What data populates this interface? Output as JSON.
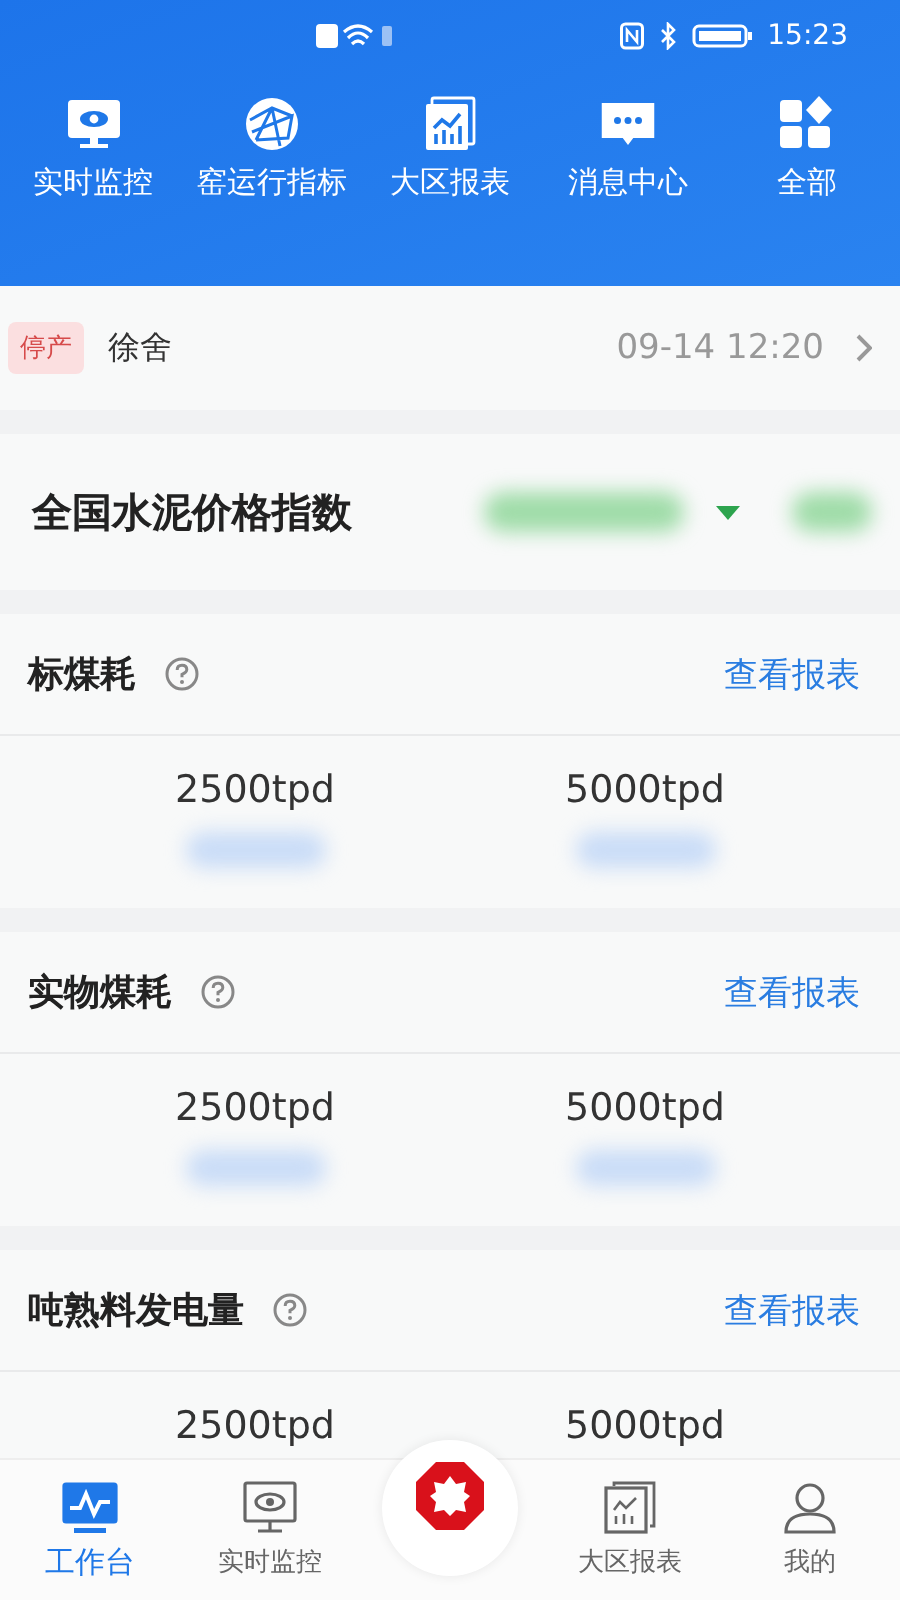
{
  "status_bar": {
    "time": "15:23"
  },
  "quick_menu": [
    {
      "label": "实时监控"
    },
    {
      "label": "窑运行指标"
    },
    {
      "label": "大区报表"
    },
    {
      "label": "消息中心"
    },
    {
      "label": "全部"
    }
  ],
  "alert": {
    "tag": "停产",
    "name": "徐舍",
    "time": "09-14 12:20"
  },
  "price_index": {
    "title": "全国水泥价格指数"
  },
  "metrics": [
    {
      "title": "标煤耗",
      "link": "查看报表",
      "columns": [
        "2500tpd",
        "5000tpd"
      ]
    },
    {
      "title": "实物煤耗",
      "link": "查看报表",
      "columns": [
        "2500tpd",
        "5000tpd"
      ]
    },
    {
      "title": "吨熟料发电量",
      "link": "查看报表",
      "columns": [
        "2500tpd",
        "5000tpd"
      ]
    }
  ],
  "tab_bar": [
    {
      "kind": "tab",
      "label": "工作台",
      "selected": true
    },
    {
      "kind": "tab",
      "label": "实时监控",
      "selected": false
    },
    {
      "kind": "center"
    },
    {
      "kind": "tab",
      "label": "大区报表",
      "selected": false
    },
    {
      "kind": "tab",
      "label": "我的",
      "selected": false
    }
  ]
}
